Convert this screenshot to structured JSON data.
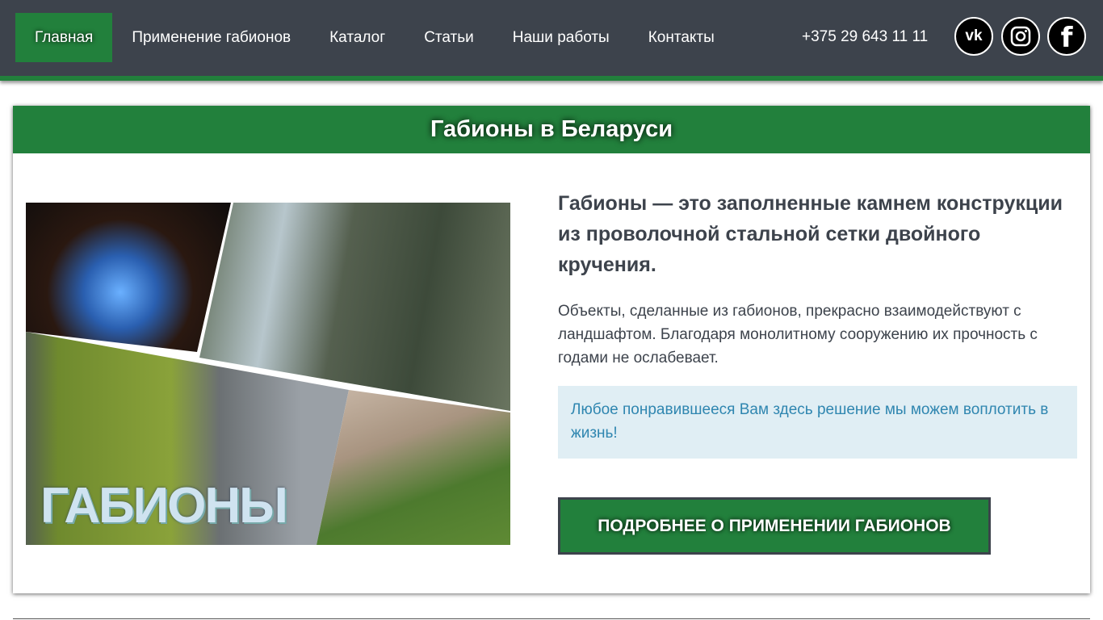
{
  "nav": {
    "items": [
      "Главная",
      "Применение габионов",
      "Каталог",
      "Статьи",
      "Наши работы",
      "Контакты"
    ],
    "phone": "+375 29 643 11 11"
  },
  "social": {
    "vk": "vk-icon",
    "instagram": "instagram-icon",
    "facebook": "facebook-icon"
  },
  "card": {
    "title": "Габионы в Беларуси",
    "image_text": "ГАБИОНЫ",
    "lead": "Габионы — это заполненные камнем конструкции из проволочной стальной сетки двойного кручения.",
    "paragraph": "Объекты, сделанные из габионов, прекрасно взаимодействуют с ландшафтом. Благодаря монолитному сооружению их прочность с годами не ослабевает.",
    "info": "Любое понравившееся Вам здесь решение мы можем воплотить в жизнь!",
    "button": "ПОДРОБНЕЕ О ПРИМЕНЕНИИ ГАБИОНОВ"
  },
  "colors": {
    "header": "#3d434c",
    "accent": "#22803c",
    "info_bg": "#e0eef4",
    "info_text": "#2f86b0"
  }
}
